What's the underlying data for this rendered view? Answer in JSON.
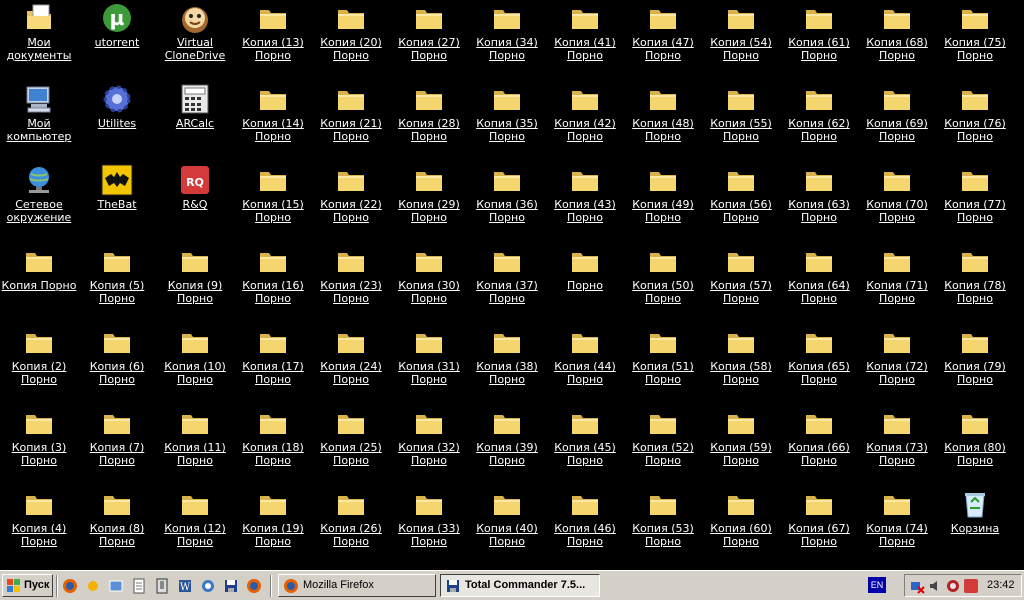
{
  "desktop": {
    "icons": [
      [
        "Мои документы",
        "Мой компьютер",
        "Сетевое окружение",
        "Копия Порно",
        "Копия (2) Порно",
        "Копия (3) Порно",
        "Копия (4) Порно"
      ],
      [
        "utorrent",
        "Utilites",
        "TheBat",
        "Копия (5) Порно",
        "Копия (6) Порно",
        "Копия (7) Порно",
        "Копия (8) Порно"
      ],
      [
        "Virtual CloneDrive",
        "ARCalc",
        "R&Q",
        "Копия (9) Порно",
        "Копия (10) Порно",
        "Копия (11) Порно",
        "Копия (12) Порно"
      ],
      [
        "Копия (13) Порно",
        "Копия (14) Порно",
        "Копия (15) Порно",
        "Копия (16) Порно",
        "Копия (17) Порно",
        "Копия (18) Порно",
        "Копия (19) Порно"
      ],
      [
        "Копия (20) Порно",
        "Копия (21) Порно",
        "Копия (22) Порно",
        "Копия (23) Порно",
        "Копия (24) Порно",
        "Копия (25) Порно",
        "Копия (26) Порно"
      ],
      [
        "Копия (27) Порно",
        "Копия (28) Порно",
        "Копия (29) Порно",
        "Копия (30) Порно",
        "Копия (31) Порно",
        "Копия (32) Порно",
        "Копия (33) Порно"
      ],
      [
        "Копия (34) Порно",
        "Копия (35) Порно",
        "Копия (36) Порно",
        "Копия (37) Порно",
        "Копия (38) Порно",
        "Копия (39) Порно",
        "Копия (40) Порно"
      ],
      [
        "Копия (41) Порно",
        "Копия (42) Порно",
        "Копия (43) Порно",
        "Порно",
        "Копия (44) Порно",
        "Копия (45) Порно",
        "Копия (46) Порно"
      ],
      [
        "Копия (47) Порно",
        "Копия (48) Порно",
        "Копия (49) Порно",
        "Копия (50) Порно",
        "Копия (51) Порно",
        "Копия (52) Порно",
        "Копия (53) Порно"
      ],
      [
        "Копия (54) Порно",
        "Копия (55) Порно",
        "Копия (56) Порно",
        "Копия (57) Порно",
        "Копия (58) Порно",
        "Копия (59) Порно",
        "Копия (60) Порно"
      ],
      [
        "Копия (61) Порно",
        "Копия (62) Порно",
        "Копия (63) Порно",
        "Копия (64) Порно",
        "Копия (65) Порно",
        "Копия (66) Порно",
        "Копия (67) Порно"
      ],
      [
        "Копия (68) Порно",
        "Копия (69) Порно",
        "Копия (70) Порно",
        "Копия (71) Порно",
        "Копия (72) Порно",
        "Копия (73) Порно",
        "Копия (74) Порно"
      ],
      [
        "Копия (75) Порно",
        "Копия (76) Порно",
        "Копия (77) Порно",
        "Копия (78) Порно",
        "Копия (79) Порно",
        "Копия (80) Порно",
        "Корзина"
      ]
    ],
    "icon_types": [
      [
        "my-documents",
        "my-computer",
        "network",
        "folder",
        "folder",
        "folder",
        "folder"
      ],
      [
        "utorrent",
        "gear",
        "thebat",
        "folder",
        "folder",
        "folder",
        "folder"
      ],
      [
        "clonedrive",
        "calculator",
        "rq",
        "folder",
        "folder",
        "folder",
        "folder"
      ],
      [
        "folder",
        "folder",
        "folder",
        "folder",
        "folder",
        "folder",
        "folder"
      ],
      [
        "folder",
        "folder",
        "folder",
        "folder",
        "folder",
        "folder",
        "folder"
      ],
      [
        "folder",
        "folder",
        "folder",
        "folder",
        "folder",
        "folder",
        "folder"
      ],
      [
        "folder",
        "folder",
        "folder",
        "folder",
        "folder",
        "folder",
        "folder"
      ],
      [
        "folder",
        "folder",
        "folder",
        "folder",
        "folder",
        "folder",
        "folder"
      ],
      [
        "folder",
        "folder",
        "folder",
        "folder",
        "folder",
        "folder",
        "folder"
      ],
      [
        "folder",
        "folder",
        "folder",
        "folder",
        "folder",
        "folder",
        "folder"
      ],
      [
        "folder",
        "folder",
        "folder",
        "folder",
        "folder",
        "folder",
        "folder"
      ],
      [
        "folder",
        "folder",
        "folder",
        "folder",
        "folder",
        "folder",
        "folder"
      ],
      [
        "folder",
        "folder",
        "folder",
        "folder",
        "folder",
        "folder",
        "recycle-bin"
      ]
    ]
  },
  "taskbar": {
    "start_label": "Пуск",
    "quick_launch": [
      "firefox-icon",
      "weather-icon",
      "show-desktop-icon",
      "notepad-icon",
      "archive-icon",
      "word-icon",
      "network-tool-icon",
      "save-icon",
      "firefox-icon"
    ],
    "tasks": [
      {
        "label": "Mozilla Firefox",
        "icon": "firefox-icon",
        "active": false
      },
      {
        "label": "Total Commander 7.5...",
        "icon": "save-icon",
        "active": true
      }
    ],
    "language": "EN",
    "tray_icons": [
      "network-disconnected-icon",
      "volume-icon",
      "antivirus-icon",
      "rq-icon"
    ],
    "clock": "23:42"
  },
  "colors": {
    "desktop_bg": "#000000",
    "folder": "#f5d66e",
    "taskbar_bg": "#d4d0c8",
    "language_bg": "#0000a8"
  }
}
